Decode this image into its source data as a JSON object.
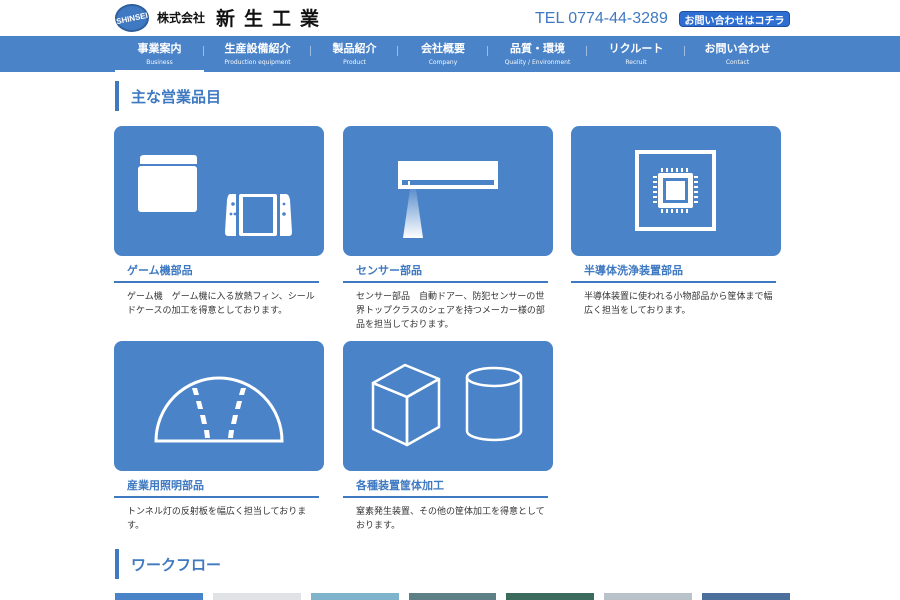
{
  "header": {
    "logo_text": "SHINSEI",
    "company_prefix": "株式会社",
    "company_name": "新生工業",
    "tel": "TEL 0774-44-3289",
    "contact_button": "お問い合わせはコチラ"
  },
  "nav": {
    "items": [
      {
        "jp": "事業案内",
        "en": "Business"
      },
      {
        "jp": "生産設備紹介",
        "en": "Production equipment"
      },
      {
        "jp": "製品紹介",
        "en": "Product"
      },
      {
        "jp": "会社概要",
        "en": "Company"
      },
      {
        "jp": "品質・環境",
        "en": "Quality / Environment"
      },
      {
        "jp": "リクルート",
        "en": "Recruit"
      },
      {
        "jp": "お問い合わせ",
        "en": "Contact"
      }
    ]
  },
  "main": {
    "section_title": "主な営業品目",
    "cards": [
      {
        "title": "ゲーム機部品",
        "desc": "ゲーム機　ゲーム機に入る放熱フィン、シールドケースの加工を得意としております。"
      },
      {
        "title": "センサー部品",
        "desc": "センサー部品　自動ドアー、防犯センサーの世界トップクラスのシェアを持つメーカー様の部品を担当しております。"
      },
      {
        "title": "半導体洗浄装置部品",
        "desc": "半導体装置に使われる小物部品から筐体まで幅広く担当をしております。"
      },
      {
        "title": "産業用照明部品",
        "desc": "トンネル灯の反射板を幅広く担当しております。"
      },
      {
        "title": "各種装置筐体加工",
        "desc": "窒素発生装置、その他の筐体加工を得意としております。"
      }
    ]
  },
  "workflow": {
    "section_title": "ワークフロー",
    "thumb_colors": [
      "#4a83c8",
      "#dfe3e6",
      "#7fb3cc",
      "#5d7f86",
      "#3c6a5c",
      "#b8c2c8",
      "#4d6f9c"
    ]
  },
  "colors": {
    "accent": "#3f79c2",
    "nav_bg": "#4a83c8"
  }
}
